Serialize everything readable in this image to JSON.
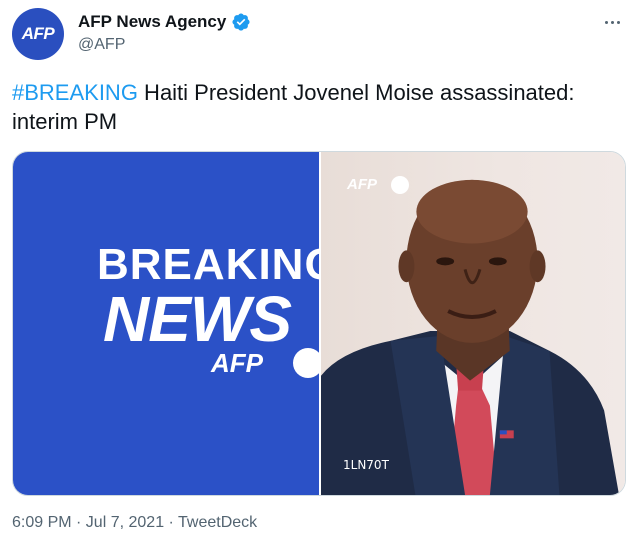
{
  "tweet": {
    "avatar_text": "AFP",
    "display_name": "AFP News Agency",
    "handle": "@AFP",
    "hashtag": "#BREAKING",
    "body": " Haiti President Jovenel Moise assassinated: interim PM",
    "timestamp": "6:09 PM · Jul 7, 2021 · TweetDeck"
  },
  "media": {
    "left_line1": "BREAKING",
    "left_line2": "NEWS",
    "left_brand": "AFP",
    "right_brand": "AFP",
    "right_code": "1LN70T"
  },
  "colors": {
    "accent": "#1d9bf0",
    "brand_blue": "#2b51c7"
  },
  "icons": {
    "verified": "verified-badge-icon",
    "more": "more-options-icon"
  }
}
